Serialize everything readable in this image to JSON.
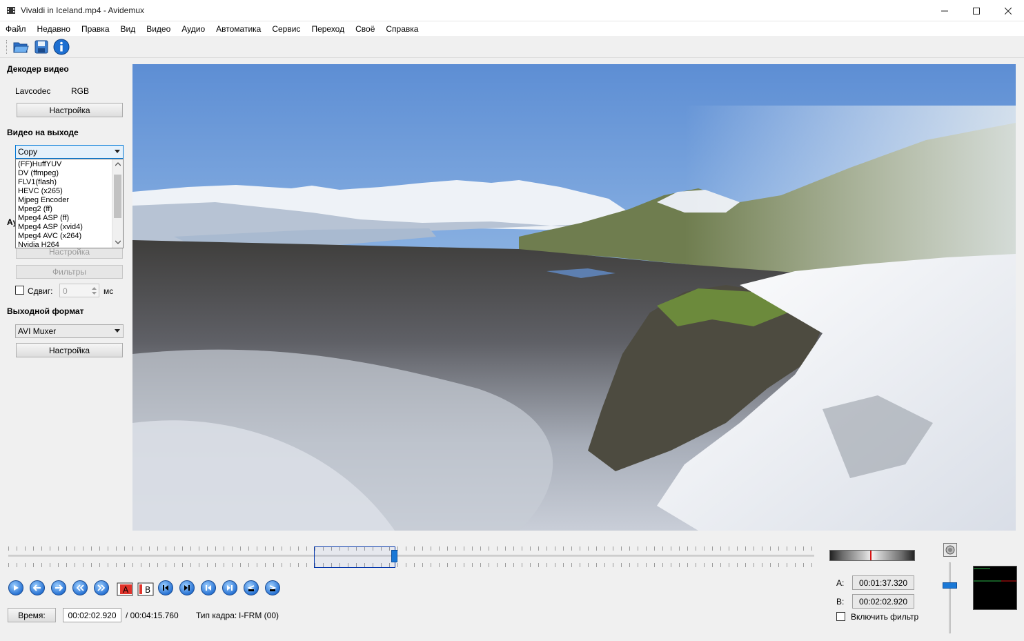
{
  "window": {
    "title": "Vivaldi in Iceland.mp4 - Avidemux"
  },
  "menu": [
    "Файл",
    "Недавно",
    "Правка",
    "Вид",
    "Видео",
    "Аудио",
    "Автоматика",
    "Сервис",
    "Переход",
    "Своё",
    "Справка"
  ],
  "toolbar": {
    "icons": [
      "open-folder-icon",
      "save-disk-icon",
      "info-icon"
    ]
  },
  "decoder": {
    "title": "Декодер видео",
    "codec": "Lavcodec",
    "colorspace": "RGB",
    "settings_label": "Настройка"
  },
  "video_output": {
    "title": "Видео на выходе",
    "selected": "Copy",
    "options": [
      "(FF)HuffYUV",
      "DV (ffmpeg)",
      "FLV1(flash)",
      "HEVC (x265)",
      "Mjpeg Encoder",
      "Mpeg2 (ff)",
      "Mpeg4 ASP (ff)",
      "Mpeg4 ASP (xvid4)",
      "Mpeg4 AVC (x264)",
      "Nvidia H264"
    ]
  },
  "audio_output": {
    "title_partial": "Ау",
    "settings_label": "Настройка",
    "filters_label": "Фильтры",
    "shift_label": "Сдвиг:",
    "shift_value": "0",
    "shift_unit": "мс",
    "shift_checked": false
  },
  "output_format": {
    "title": "Выходной формат",
    "selected": "AVI Muxer",
    "settings_label": "Настройка"
  },
  "timeline": {
    "position_fraction": 0.685,
    "selection_start_fraction": 0.6,
    "selection_end_fraction": 0.685
  },
  "playback_buttons": [
    "play-icon",
    "previous-frame-icon",
    "next-frame-icon",
    "previous-keyframe-icon",
    "next-keyframe-icon",
    "set-marker-a-icon",
    "set-marker-b-icon",
    "previous-cut-icon",
    "next-cut-icon",
    "go-to-marker-a-icon",
    "go-to-marker-b-icon",
    "go-to-first-frame-icon",
    "go-to-last-frame-icon"
  ],
  "time": {
    "button_label": "Время:",
    "current": "00:02:02.920",
    "total": "/ 00:04:15.760",
    "frame_type_label": "Тип кадра:",
    "frame_type_value": "I-FRM (00)"
  },
  "markers": {
    "a_label": "A:",
    "a_value": "00:01:37.320",
    "b_label": "B:",
    "b_value": "00:02:02.920",
    "filter_label": "Включить фильтр",
    "filter_checked": false
  },
  "volume": {
    "level_fraction": 0.7
  }
}
